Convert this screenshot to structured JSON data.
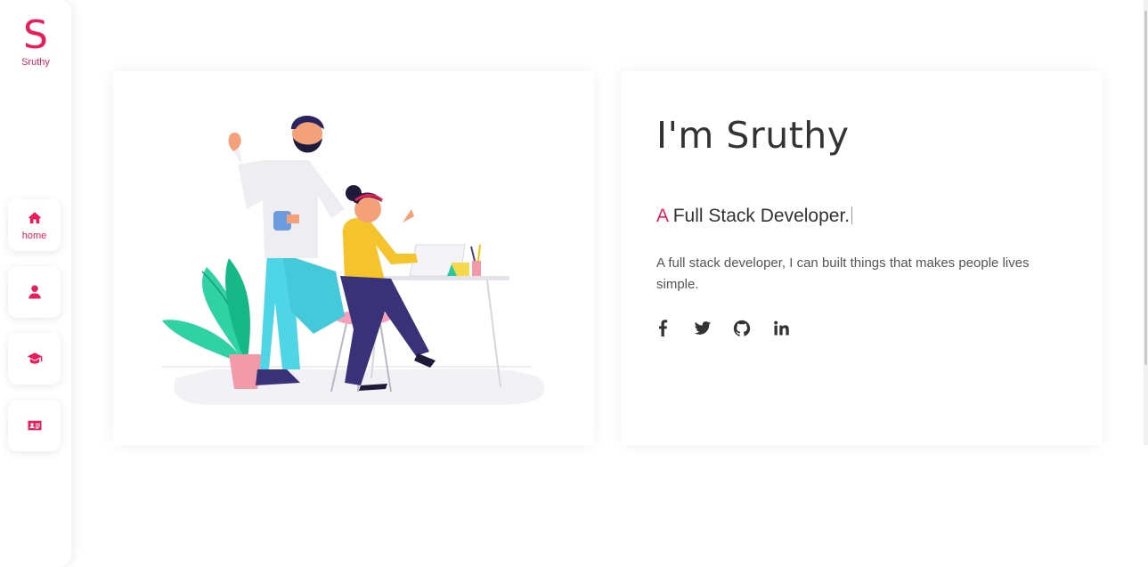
{
  "sidebar": {
    "logo_letter": "S",
    "logo_name": "Sruthy",
    "nav": [
      {
        "icon": "home-icon",
        "label": "home"
      },
      {
        "icon": "user-icon",
        "label": ""
      },
      {
        "icon": "graduation-cap-icon",
        "label": ""
      },
      {
        "icon": "contact-card-icon",
        "label": ""
      }
    ]
  },
  "hero": {
    "title": "I'm Sruthy",
    "subtitle_prefix": "A",
    "subtitle_rest": " Full Stack Developer.",
    "description": "A full stack developer, I can built things that makes people lives simple."
  },
  "socials": [
    "facebook-icon",
    "twitter-icon",
    "github-icon",
    "linkedin-icon"
  ],
  "colors": {
    "accent": "#ec1c5b",
    "text": "#333333",
    "muted": "#555555"
  }
}
